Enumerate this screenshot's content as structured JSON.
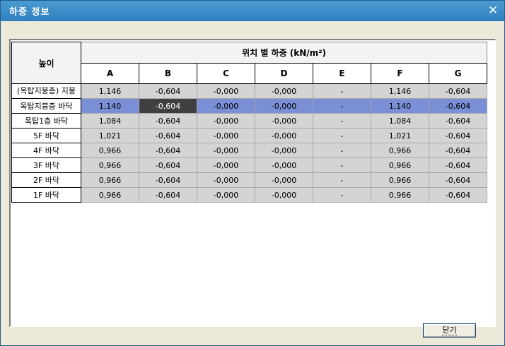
{
  "window": {
    "title": "하중 정보",
    "close_glyph": "✕"
  },
  "table": {
    "height_header": "높이",
    "group_header": "위치 별 하중 (kN/m²)",
    "columns": [
      "A",
      "B",
      "C",
      "D",
      "E",
      "F",
      "G"
    ],
    "rows": [
      {
        "label": "(옥탑지붕층) 지붕",
        "values": [
          "1,146",
          "-0,604",
          "-0,000",
          "-0,000",
          "-",
          "1,146",
          "-0,604"
        ]
      },
      {
        "label": "옥탑지붕층 바닥",
        "values": [
          "1,140",
          "-0,604",
          "-0,000",
          "-0,000",
          "-",
          "1,140",
          "-0,604"
        ]
      },
      {
        "label": "옥탑1층 바닥",
        "values": [
          "1,084",
          "-0,604",
          "-0,000",
          "-0,000",
          "-",
          "1,084",
          "-0,604"
        ]
      },
      {
        "label": "5F 바닥",
        "values": [
          "1,021",
          "-0,604",
          "-0,000",
          "-0,000",
          "-",
          "1,021",
          "-0,604"
        ]
      },
      {
        "label": "4F 바닥",
        "values": [
          "0,966",
          "-0,604",
          "-0,000",
          "-0,000",
          "-",
          "0,966",
          "-0,604"
        ]
      },
      {
        "label": "3F 바닥",
        "values": [
          "0,966",
          "-0,604",
          "-0,000",
          "-0,000",
          "-",
          "0,966",
          "-0,604"
        ]
      },
      {
        "label": "2F 바닥",
        "values": [
          "0,966",
          "-0,604",
          "-0,000",
          "-0,000",
          "-",
          "0,966",
          "-0,604"
        ]
      },
      {
        "label": "1F 바닥",
        "values": [
          "0,966",
          "-0,604",
          "-0,000",
          "-0,000",
          "-",
          "0,966",
          "-0,604"
        ]
      }
    ],
    "selected_row": 1,
    "active_column": 1
  },
  "footer": {
    "close_button_label": "닫기"
  },
  "colors": {
    "titlebar": "#2f80c0",
    "selection": "#7a8fd6",
    "active_cell": "#404040",
    "cell_bg": "#d4d4d4"
  }
}
